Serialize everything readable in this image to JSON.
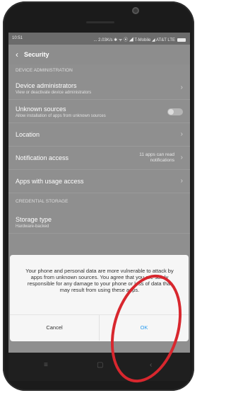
{
  "statusbar": {
    "time": "10:51",
    "right_text": "... 2.03K/s ✱ ᯤ ⦿ ◢ T-Mobile ◢ AT&T LTE"
  },
  "header": {
    "title": "Security"
  },
  "sections": {
    "device_admin": "DEVICE ADMINISTRATION",
    "credential_storage": "CREDENTIAL STORAGE"
  },
  "rows": {
    "device_admins": {
      "label": "Device administrators",
      "sub": "View or deactivate device administrators"
    },
    "unknown_sources": {
      "label": "Unknown sources",
      "sub": "Allow installation of apps from unknown sources"
    },
    "location": {
      "label": "Location"
    },
    "notification_access": {
      "label": "Notification access",
      "value": "11 apps can read notifications"
    },
    "usage_access": {
      "label": "Apps with usage access"
    },
    "storage_type": {
      "label": "Storage type",
      "sub": "Hardware-backed"
    }
  },
  "dialog": {
    "message": "Your phone and personal data are more vulnerable to attack by apps from unknown sources. You agree that you are solely responsible for any damage to your phone or loss of data that may result from using these apps.",
    "cancel": "Cancel",
    "ok": "OK"
  },
  "nav": {
    "menu": "≡",
    "home": "▢",
    "back": "‹"
  },
  "colors": {
    "accent": "#2d9df1",
    "annotation": "#d8272e"
  }
}
